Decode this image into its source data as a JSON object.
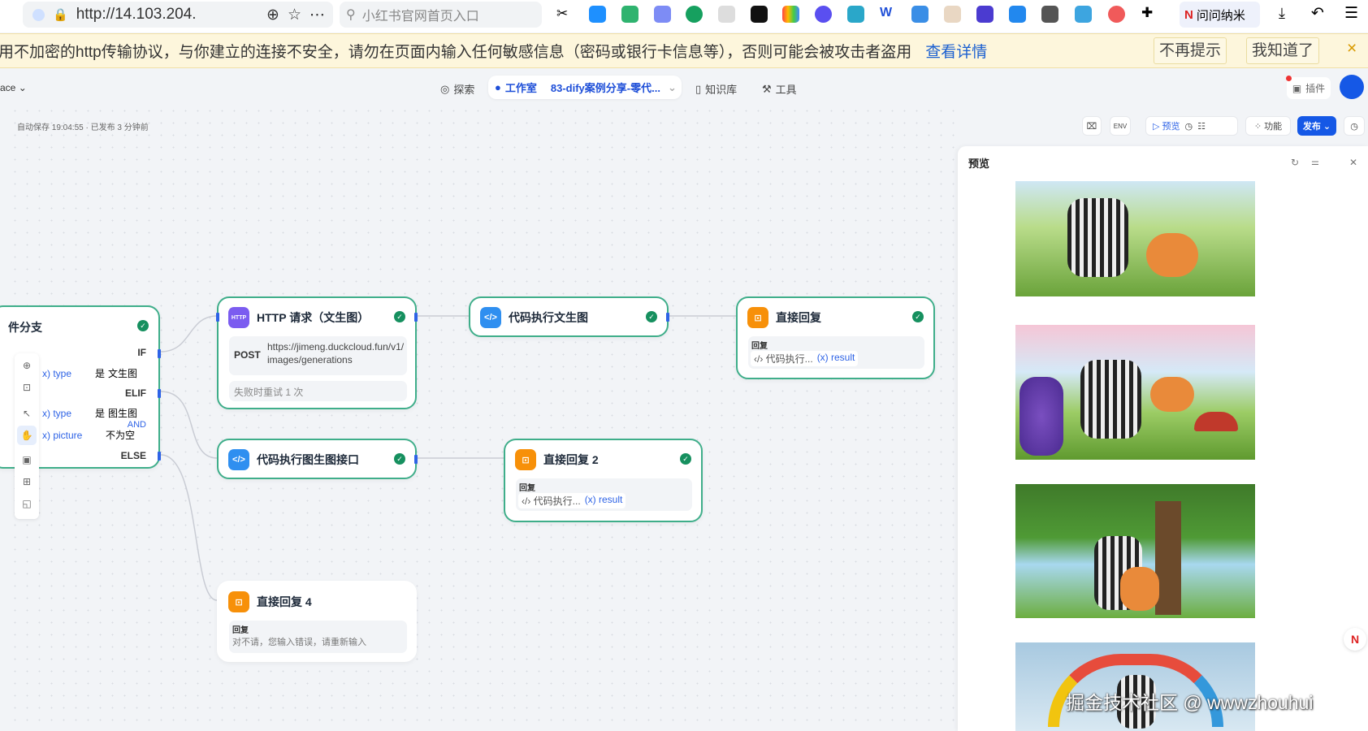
{
  "browser": {
    "url": "http://14.103.204.",
    "search_placeholder": "小红书官网首页入口",
    "profile_label": "问问纳米"
  },
  "security_bar": {
    "message": "用不加密的http传输协议，与你建立的连接不安全，请勿在页面内输入任何敏感信息（密码或银行卡信息等），否则可能会被攻击者盗用",
    "details_link": "查看详情",
    "dont_remind": "不再提示",
    "got_it": "我知道了",
    "close": "×"
  },
  "app_header": {
    "workspace": "ace",
    "nav": {
      "explore": "探索",
      "studio": "工作室",
      "app_name": "83-dify案例分享-零代...",
      "knowledge": "知识库",
      "tools": "工具"
    },
    "plugins": "插件"
  },
  "status": {
    "autosave": "自动保存 19:04:55 · 已发布 3 分钟前"
  },
  "toolbar": {
    "preview": "预览",
    "features": "功能",
    "publish": "发布"
  },
  "nodes": {
    "condition": {
      "title": "件分支",
      "if": "IF",
      "elif": "ELIF",
      "else": "ELSE",
      "and": "AND",
      "rows": [
        {
          "var": "x) type",
          "op": "是",
          "value": "文生图"
        },
        {
          "var": "x) type",
          "op": "是",
          "value": "图生图"
        },
        {
          "var": "x) picture",
          "op": "不为空",
          "value": ""
        }
      ]
    },
    "http": {
      "title": "HTTP 请求（文生图）",
      "icon": "HTTP",
      "method": "POST",
      "url": "https://jimeng.duckcloud.fun/v1/images/generations",
      "retry": "失败时重试 1 次"
    },
    "code1": {
      "title": "代码执行文生图"
    },
    "reply1": {
      "title": "直接回复",
      "label": "回复",
      "src": "代码执行...",
      "var": "result"
    },
    "code2": {
      "title": "代码执行图生图接口"
    },
    "reply2": {
      "title": "直接回复 2",
      "label": "回复",
      "src": "代码执行...",
      "var": "result"
    },
    "reply4": {
      "title": "直接回复 4",
      "label": "回复",
      "text": "对不请，您输入错误，请重新输入"
    }
  },
  "preview_panel": {
    "title": "预览",
    "images": [
      "zebra-cat-meadow",
      "zebra-cat-iris-butterflies",
      "zebra-cat-tree-rainbow",
      "zebra-cat-rainbow"
    ]
  },
  "watermark": "掘金技术社区 @ wwwzhouhui",
  "colors": {
    "accent": "#2e63e6",
    "node_border": "#3fae8a",
    "ok": "#16905f",
    "warn_bg": "#fdf6dc"
  }
}
